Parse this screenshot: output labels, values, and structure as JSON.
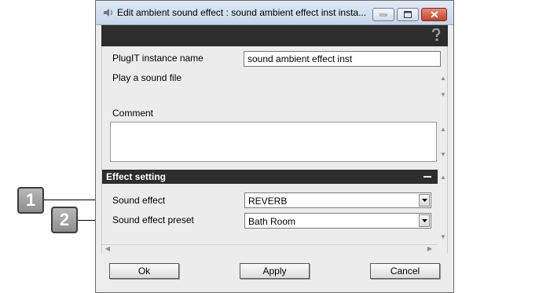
{
  "window": {
    "title": "Edit ambient sound effect : sound ambient effect inst insta..."
  },
  "fields": {
    "instance_name_label": "PlugIT instance name",
    "instance_name_value": "sound ambient effect inst",
    "description": "Play a sound file",
    "comment_label": "Comment",
    "comment_value": ""
  },
  "effect_setting": {
    "header": "Effect setting",
    "sound_effect_label": "Sound effect",
    "sound_effect_value": "REVERB",
    "preset_label": "Sound effect preset",
    "preset_value": "Bath Room"
  },
  "buttons": {
    "ok": "Ok",
    "apply": "Apply",
    "cancel": "Cancel"
  },
  "callouts": [
    "1",
    "2"
  ],
  "icons": {
    "app": "speaker-icon",
    "help": "help-icon",
    "minimize": "minimize-icon",
    "maximize": "maximize-icon",
    "close": "close-icon",
    "dropdown": "chevron-down-icon",
    "collapse": "collapse-icon"
  },
  "colors": {
    "dark_bar": "#2d2d2d",
    "close_button": "#c5432b",
    "titlebar": "#c6d6ea"
  }
}
